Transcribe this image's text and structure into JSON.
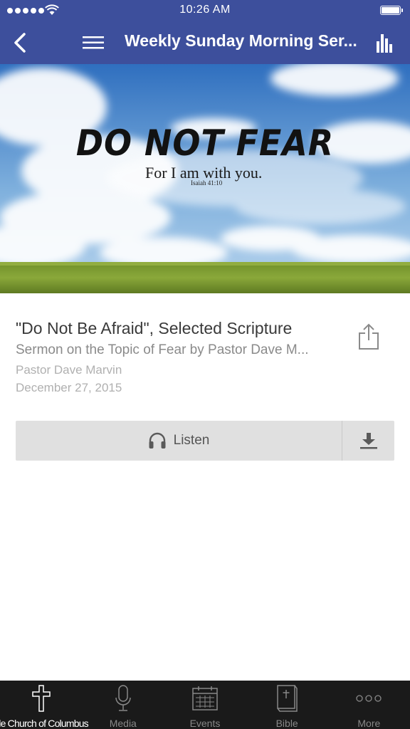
{
  "status_bar": {
    "time": "10:26 AM"
  },
  "navbar": {
    "title": "Weekly Sunday Morning Ser..."
  },
  "hero": {
    "heading": "DO NOT FEAR",
    "subheading": "For I am with you.",
    "reference": "Isaiah 41:10"
  },
  "sermon": {
    "title": "\"Do Not Be Afraid\", Selected Scripture",
    "subtitle": "Sermon on the Topic of Fear by Pastor Dave M...",
    "speaker": "Pastor Dave Marvin",
    "date": "December 27, 2015"
  },
  "actions": {
    "listen_label": "Listen"
  },
  "tabs": [
    {
      "label": "ble Church of Columbus",
      "icon": "cross-icon"
    },
    {
      "label": "Media",
      "icon": "microphone-icon"
    },
    {
      "label": "Events",
      "icon": "calendar-icon"
    },
    {
      "label": "Bible",
      "icon": "bible-icon"
    },
    {
      "label": "More",
      "icon": "more-icon"
    }
  ],
  "colors": {
    "nav_bar": "#3d4f9c",
    "tab_bar": "#1a1a1a",
    "action_bar": "#e0e0e0"
  }
}
